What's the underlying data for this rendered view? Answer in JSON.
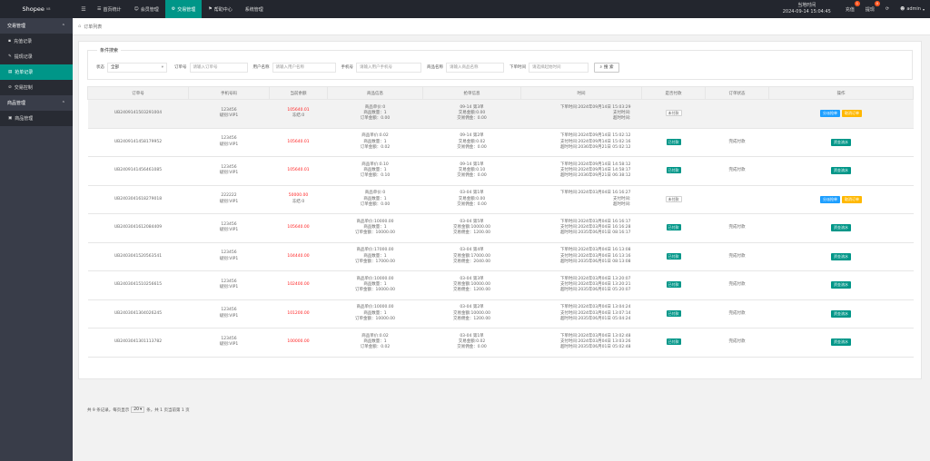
{
  "brand": {
    "name": "Shopee",
    "sup": "V8"
  },
  "topnav": [
    {
      "label": "首页统计",
      "icon": "☰",
      "active": false
    },
    {
      "label": "会员管理",
      "icon": "☺",
      "active": false
    },
    {
      "label": "交易管理",
      "icon": "⚙",
      "active": true
    },
    {
      "label": "帮助中心",
      "icon": "⚑",
      "active": false
    },
    {
      "label": "系统管理",
      "icon": "",
      "active": false
    }
  ],
  "clock": {
    "label": "当地时间",
    "time": "2024-09-14 15:04:45"
  },
  "top_right": {
    "recharge": "充值",
    "recharge_badge": "1",
    "withdraw": "提现",
    "withdraw_badge": "0",
    "refresh_icon": "⟳",
    "user": "admin"
  },
  "sidebar": {
    "group1": "交易管理",
    "items1": [
      {
        "label": "充值记录",
        "icon": "▪",
        "active": false
      },
      {
        "label": "提现记录",
        "icon": "✎",
        "active": false
      },
      {
        "label": "抢单记录",
        "icon": "▤",
        "active": true
      },
      {
        "label": "交易控制",
        "icon": "⊘",
        "active": false
      }
    ],
    "group2": "商品管理",
    "items2": [
      {
        "label": "商品管理",
        "icon": "▣",
        "active": false
      }
    ]
  },
  "breadcrumb": {
    "home": "⌂",
    "title": "订单列表"
  },
  "filter": {
    "legend": "条件搜索",
    "status_label": "状态",
    "status_value": "全部",
    "order_label": "订单号",
    "order_ph": "请输入订单号",
    "user_label": "用户名称",
    "user_ph": "请输入用户名称",
    "phone_label": "手机号",
    "phone_ph": "请输入用户手机号",
    "goods_label": "商品名称",
    "goods_ph": "请输入商品名称",
    "time_label": "下单时间",
    "time_ph": "请选择起始时间",
    "search_btn": "搜 索"
  },
  "table": {
    "headers": [
      "订单号",
      "手机号码",
      "当前余额",
      "商品信息",
      "抢单信息",
      "时间",
      "是否付款",
      "订单状态",
      "操作"
    ],
    "rows": [
      {
        "order": "UB2409141503291004",
        "phone": "123456",
        "level": "级别:VIP1",
        "bal1": "105640.01",
        "bal2": "冻结:0",
        "g1": "商品单价:0",
        "g2": "商品数量：1",
        "g3": "订单金额：0.00",
        "q1": "09-14 第3单",
        "q2": "交易金额:0.00",
        "q3": "交易佣金：0.00",
        "t1": "下单时间:2024年09月14日 15:03:29",
        "t2": "支付时间:",
        "t3": "超时时间:",
        "pay": "未付款",
        "paid": false,
        "status": "",
        "ops": [
          "分派抢单",
          "取消订单"
        ]
      },
      {
        "order": "UB2409141458179952",
        "phone": "123456",
        "level": "级别:VIP1",
        "bal1": "105640.01",
        "bal2": "",
        "g1": "商品单价:0.02",
        "g2": "商品数量：1",
        "g3": "订单金额：0.02",
        "q1": "09-14 第2单",
        "q2": "交易金额:0.02",
        "q3": "交易佣金：0.00",
        "t1": "下单时间:2024年09月14日 15:02:12",
        "t2": "支付时间:2024年09月14日 15:02:16",
        "t3": "超时时间:2036年09月21日 05:02:12",
        "pay": "已付款",
        "paid": true,
        "status": "完成付款",
        "ops": [
          "资金流水"
        ]
      },
      {
        "order": "UB2409141456461085",
        "phone": "123456",
        "level": "级别:VIP1",
        "bal1": "105640.01",
        "bal2": "",
        "g1": "商品单价:0.10",
        "g2": "商品数量：1",
        "g3": "订单金额：0.10",
        "q1": "09-14 第1单",
        "q2": "交易金额:0.10",
        "q3": "交易佣金：0.00",
        "t1": "下单时间:2024年09月14日 14:58:12",
        "t2": "支付时间:2024年09月14日 14:58:17",
        "t3": "超时时间:2036年09月21日 06:38:12",
        "pay": "已付款",
        "paid": true,
        "status": "完成付款",
        "ops": [
          "资金流水"
        ]
      },
      {
        "order": "UB2403041618279018",
        "phone": "222222",
        "level": "级别:VIP1",
        "bal1": "50000.00",
        "bal2": "冻结:0",
        "g1": "商品单价:0",
        "g2": "商品数量：1",
        "g3": "订单金额：0.00",
        "q1": "03-04 第1单",
        "q2": "交易金额:0.00",
        "q3": "交易佣金：0.00",
        "t1": "下单时间:2024年03月04日 16:16:27",
        "t2": "支付时间:",
        "t3": "超时时间:",
        "pay": "未付款",
        "paid": false,
        "status": "",
        "ops": [
          "分派抢单",
          "取消订单"
        ]
      },
      {
        "order": "UB2403041612084409",
        "phone": "123456",
        "level": "级别:VIP1",
        "bal1": "105640.00",
        "bal2": "",
        "g1": "商品单价:10000.00",
        "g2": "商品数量：1",
        "g3": "订单金额：10000.00",
        "q1": "03-04 第5单",
        "q2": "交易金额:10000.00",
        "q3": "交易佣金：1200.00",
        "t1": "下单时间:2024年03月04日 16:16:17",
        "t2": "支付时间:2024年03月04日 16:16:28",
        "t3": "超时时间:2035年06月01日 08:16:17",
        "pay": "已付款",
        "paid": true,
        "status": "完成付款",
        "ops": [
          "资金流水"
        ]
      },
      {
        "order": "UB2403041520563541",
        "phone": "123456",
        "level": "级别:VIP1",
        "bal1": "104440.00",
        "bal2": "",
        "g1": "商品单价:17000.00",
        "g2": "商品数量：1",
        "g3": "订单金额：17000.00",
        "q1": "03-04 第4单",
        "q2": "交易金额:17000.00",
        "q3": "交易佣金：2040.00",
        "t1": "下单时间:2024年03月04日 16:13:08",
        "t2": "支付时间:2024年03月04日 16:13:16",
        "t3": "超时时间:2035年06月01日 08:13:08",
        "pay": "已付款",
        "paid": true,
        "status": "完成付款",
        "ops": [
          "资金流水"
        ]
      },
      {
        "order": "UB2403041510256615",
        "phone": "123456",
        "level": "级别:VIP1",
        "bal1": "102400.00",
        "bal2": "",
        "g1": "商品单价:10000.00",
        "g2": "商品数量：1",
        "g3": "订单金额：10000.00",
        "q1": "03-04 第3单",
        "q2": "交易金额:10000.00",
        "q3": "交易佣金：1200.00",
        "t1": "下单时间:2024年03月04日 13:20:07",
        "t2": "支付时间:2024年03月04日 13:20:21",
        "t3": "超时时间:2035年06月01日 05:20:07",
        "pay": "已付款",
        "paid": true,
        "status": "完成付款",
        "ops": [
          "资金流水"
        ]
      },
      {
        "order": "UB2403041304026245",
        "phone": "123456",
        "level": "级别:VIP1",
        "bal1": "101200.00",
        "bal2": "",
        "g1": "商品单价:10000.00",
        "g2": "商品数量：1",
        "g3": "订单金额：10000.00",
        "q1": "03-04 第2单",
        "q2": "交易金额:10000.00",
        "q3": "交易佣金：1200.00",
        "t1": "下单时间:2024年03月04日 13:04:24",
        "t2": "支付时间:2024年03月04日 13:07:14",
        "t3": "超时时间:2035年06月01日 05:04:24",
        "pay": "已付款",
        "paid": true,
        "status": "完成付款",
        "ops": [
          "资金流水"
        ]
      },
      {
        "order": "UB2403041301113782",
        "phone": "123456",
        "level": "级别:VIP1",
        "bal1": "100000.00",
        "bal2": "",
        "g1": "商品单价:0.02",
        "g2": "商品数量：1",
        "g3": "订单金额：0.02",
        "q1": "03-04 第1单",
        "q2": "交易金额:0.02",
        "q3": "交易佣金：0.00",
        "t1": "下单时间:2024年03月04日 13:02:48",
        "t2": "支付时间:2024年03月04日 13:03:26",
        "t3": "超时时间:2035年06月01日 05:02:48",
        "pay": "已付款",
        "paid": true,
        "status": "完成付款",
        "ops": [
          "资金流水"
        ]
      }
    ]
  },
  "pager": {
    "prefix": "共 9 条记录，每页显示",
    "size": "20",
    "suffix": "条，共 1 页当前第 1 页"
  }
}
